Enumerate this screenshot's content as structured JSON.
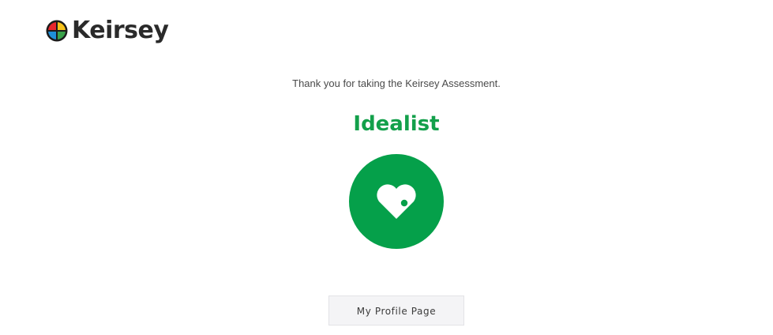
{
  "brand": {
    "name": "Keirsey",
    "logo_icon": "quartered-color-circle-icon",
    "logo_colors": [
      "#e8262c",
      "#f6c21b",
      "#1f8fd8",
      "#39a24a"
    ]
  },
  "main": {
    "thank_you_text": "Thank you for taking the Keirsey Assessment.",
    "temperament": "Idealist",
    "temperament_color": "#13a04b",
    "temperament_icon": "heart-icon",
    "profile_button_label": "My Profile Page"
  }
}
